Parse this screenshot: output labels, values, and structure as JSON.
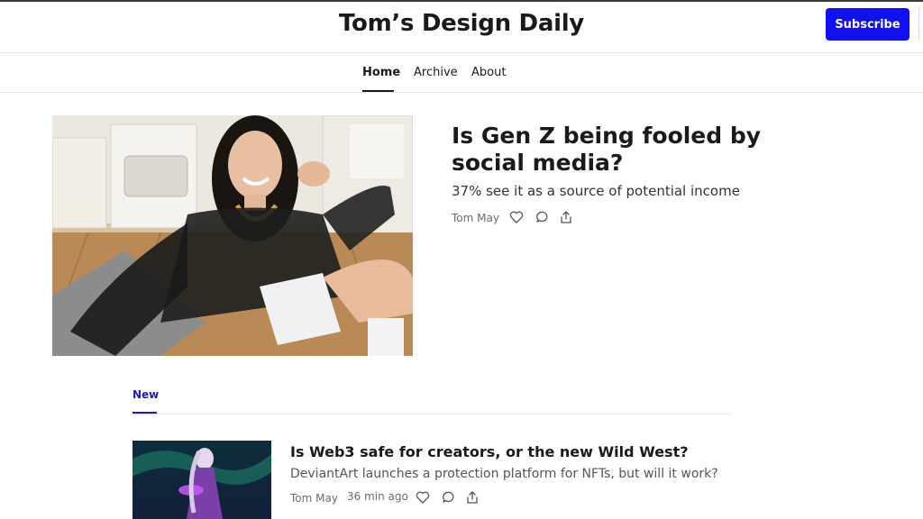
{
  "header": {
    "site_title": "Tom’s Design Daily",
    "subscribe_label": "Subscribe",
    "accent_color": "#1010f0"
  },
  "nav": {
    "items": [
      {
        "label": "Home",
        "active": true
      },
      {
        "label": "Archive",
        "active": false
      },
      {
        "label": "About",
        "active": false
      }
    ]
  },
  "hero": {
    "title": "Is Gen Z being fooled by social media?",
    "subtitle": "37% see it as a source of potential income",
    "author": "Tom May",
    "image": "woman-taking-selfie-in-kitchen",
    "actions": [
      "heart-icon",
      "comment-icon",
      "share-icon"
    ]
  },
  "feed": {
    "tab_label": "New",
    "tab_color": "#1a1acc",
    "posts": [
      {
        "title": "Is Web3 safe for creators, or the new Wild West?",
        "subtitle": "DeviantArt launches a protection platform for NFTs, but will it work?",
        "author": "Tom May",
        "time": "36 min ago",
        "image": "fantasy-character-illustration",
        "actions": [
          "heart-icon",
          "comment-icon",
          "share-icon"
        ]
      }
    ]
  }
}
